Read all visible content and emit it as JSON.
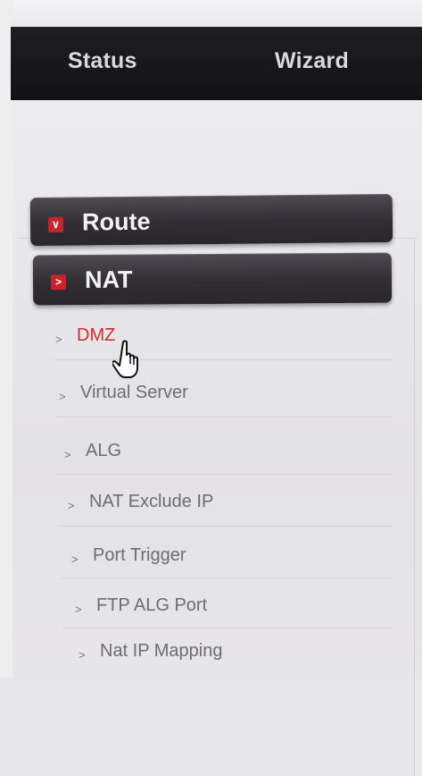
{
  "top_nav": {
    "tabs": [
      {
        "label": "Status"
      },
      {
        "label": "Wizard"
      }
    ]
  },
  "sidebar": {
    "sections": [
      {
        "label": "Route",
        "badge": "∨",
        "expanded": false
      },
      {
        "label": "NAT",
        "badge": ">",
        "expanded": true
      }
    ],
    "nat_items": [
      {
        "label": "DMZ",
        "active": true
      },
      {
        "label": "Virtual Server"
      },
      {
        "label": "ALG"
      },
      {
        "label": "NAT Exclude IP"
      },
      {
        "label": "Port Trigger"
      },
      {
        "label": "FTP ALG Port"
      },
      {
        "label": "Nat IP Mapping"
      }
    ],
    "item_arrow": ">"
  },
  "colors": {
    "nav_bg": "#161618",
    "header_bg": "#35323a",
    "badge_red": "#c8252b",
    "active_text": "#d42a28",
    "item_text": "#6e6d70"
  }
}
